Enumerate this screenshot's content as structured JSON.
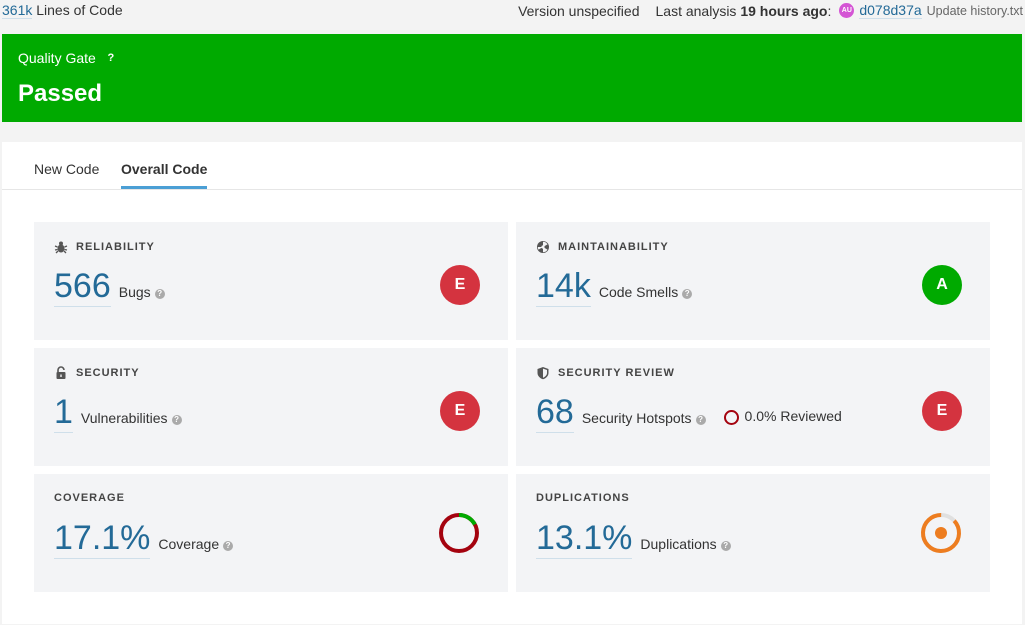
{
  "topbar": {
    "loc_value": "361k",
    "loc_label": "Lines of Code",
    "version": "Version unspecified",
    "last_analysis_label": "Last analysis",
    "last_analysis_time": "19 hours ago",
    "last_analysis_colon": ":",
    "avatar_initials": "AU",
    "commit_hash": "d078d37a",
    "commit_message": "Update history.txt"
  },
  "quality_gate": {
    "label": "Quality Gate",
    "help": "?",
    "status": "Passed",
    "color": "#00aa00"
  },
  "tabs": [
    {
      "label": "New Code",
      "active": false
    },
    {
      "label": "Overall Code",
      "active": true
    }
  ],
  "cards": {
    "reliability": {
      "title": "RELIABILITY",
      "value": "566",
      "label": "Bugs",
      "grade": "E",
      "grade_color": "#d4333f"
    },
    "maintainability": {
      "title": "MAINTAINABILITY",
      "value": "14k",
      "label": "Code Smells",
      "grade": "A",
      "grade_color": "#00aa00"
    },
    "security": {
      "title": "SECURITY",
      "value": "1",
      "label": "Vulnerabilities",
      "grade": "E",
      "grade_color": "#d4333f"
    },
    "security_review": {
      "title": "SECURITY REVIEW",
      "value": "68",
      "label": "Security Hotspots",
      "reviewed": "0.0% Reviewed",
      "grade": "E",
      "grade_color": "#d4333f"
    },
    "coverage": {
      "title": "COVERAGE",
      "value": "17.1%",
      "label": "Coverage",
      "percent": 17.1
    },
    "duplications": {
      "title": "DUPLICATIONS",
      "value": "13.1%",
      "label": "Duplications",
      "percent": 13.1
    }
  },
  "icons": {
    "reliability": "bug-icon",
    "maintainability": "radiation-icon",
    "security": "lock-icon",
    "security_review": "shield-icon",
    "help": "question-icon"
  }
}
